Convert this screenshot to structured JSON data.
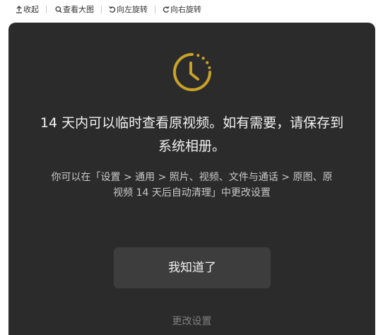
{
  "toolbar": {
    "items": [
      {
        "label": "收起",
        "icon": "collapse-icon"
      },
      {
        "label": "查看大图",
        "icon": "search-icon"
      },
      {
        "label": "向左旋转",
        "icon": "rotate-left-icon"
      },
      {
        "label": "向右旋转",
        "icon": "rotate-right-icon"
      }
    ]
  },
  "dialog": {
    "icon": "clock-timer-icon",
    "accent_color": "#c9a227",
    "headline_lines": [
      "14 天内可以临时查看原视频。如有需要，请保存到",
      "系统相册。"
    ],
    "description_lines": [
      "你可以在「设置 > 通用 > 照片、视频、文件与通话 > 原图、原",
      "视频 14 天后自动清理」中更改设置"
    ],
    "confirm_label": "我知道了",
    "settings_label": "更改设置"
  }
}
